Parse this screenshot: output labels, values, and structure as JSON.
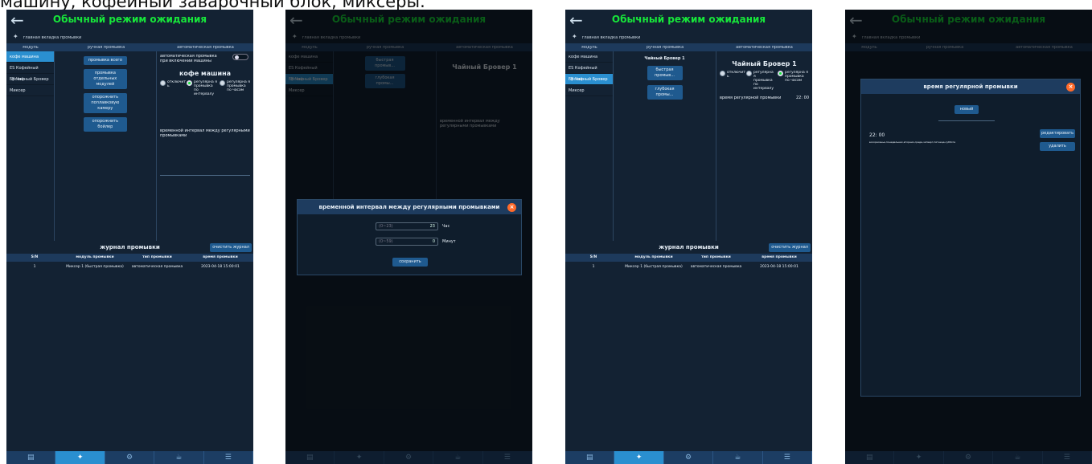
{
  "caption": "машину, кофейный заварочный блок, миксеры.",
  "screen": {
    "title": "Обычный режим ожидания",
    "breadcrumb": "главная вкладка промывки",
    "columns": [
      "модуль",
      "ручная промывка",
      "автоматическая промывка"
    ]
  },
  "screen1": {
    "modules": [
      "кофе машина",
      "ES Кофейный Бровер",
      "FB Чайный Бровер",
      "Миксер"
    ],
    "manual_buttons": [
      "промывка всего",
      "промывка отдельных модулей",
      "опорожнить поплавковую камеру",
      "опорожнить бойлер"
    ],
    "auto_on_start": "автоматическая промывка при включении машины",
    "module_title": "кофе машина",
    "radio_labels": [
      "отключит ь",
      "регулярна я промывка по интервалу",
      "регулярна я промывка по часам"
    ],
    "interval_label": "временной интервал между регулярными промывками"
  },
  "journal": {
    "title": "журнал промывки",
    "clear_button": "очистить журнал",
    "headers": [
      "S/N",
      "модуль промывки",
      "тип промывки",
      "время промывки"
    ],
    "row": {
      "sn": "1",
      "module": "Миксер 1 (быстрая промывка)",
      "type": "автоматическая промывка",
      "time": "2023-04-18 15:00:01"
    }
  },
  "screen3": {
    "modules": [
      "кофе машина",
      "ES Кофейный Бровер",
      "FB Чайный Бровер",
      "Миксер"
    ],
    "module_title": "Чайный Бровер 1",
    "manual_buttons": [
      "Чайный Бровер 1",
      "быстрая промыв...",
      "глубокая промы..."
    ],
    "radio_labels": [
      "отключит ь",
      "регулярна я промывка по интервалу",
      "регулярна я промывка по часам"
    ],
    "regular_time_label": "время регулярной промывки",
    "regular_time_value": "22: 00"
  },
  "modal_interval": {
    "title": "временной интервал между регулярными промывками",
    "hours_hint": "(0~23)",
    "hours_value": "23",
    "hours_unit": "Час",
    "minutes_hint": "(0~59)",
    "minutes_value": "0",
    "minutes_unit": "Минут",
    "save": "сохранить"
  },
  "modal_time": {
    "title": "время регулярной промывки",
    "new_button": "новый",
    "time": "22: 00",
    "days": "воскресенье,понедельник,вторник,среда,четверг,пятница,суббота",
    "edit": "редактировать",
    "delete": "удалить"
  },
  "nav": {
    "tab_label": "главная вкладка промывки"
  }
}
